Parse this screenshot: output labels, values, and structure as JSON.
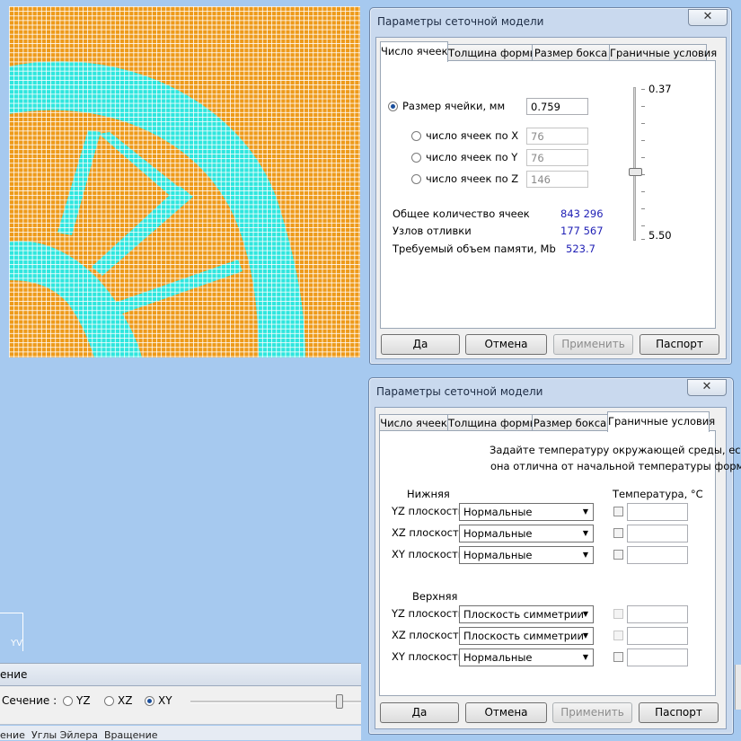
{
  "viewport": {
    "colors": {
      "mesh": "#ee9a1a",
      "casting": "#2fe6de",
      "grid": "#ffffff",
      "background": "#a6c9ef"
    }
  },
  "left_panel": {
    "axes_label": "YV",
    "section_header": "ение",
    "section_label": "Сечение :",
    "planes": [
      {
        "label": "YZ",
        "selected": false
      },
      {
        "label": "XZ",
        "selected": false
      },
      {
        "label": "XY",
        "selected": true
      }
    ],
    "bottom_tabs": [
      "ение",
      "Углы Эйлера",
      "Вращение"
    ]
  },
  "dialog1": {
    "title": "Параметры сеточной модели",
    "close": "✕",
    "tabs": [
      "Число ячеек",
      "Толщина формы",
      "Размер бокса",
      "Граничные условия"
    ],
    "active_tab": 0,
    "cell_size_label": "Размер ячейки, мм",
    "cell_size_value": "0.759",
    "cells_x_label": "число ячеек по X",
    "cells_x_value": "76",
    "cells_y_label": "число ячеек по Y",
    "cells_y_value": "76",
    "cells_z_label": "число ячеек по Z",
    "cells_z_value": "146",
    "total_cells_label": "Общее количество ячеек",
    "total_cells_value": "843 296",
    "casting_nodes_label": "Узлов отливки",
    "casting_nodes_value": "177 567",
    "memory_label": "Требуемый объем памяти, Mb",
    "memory_value": "523.7",
    "slider_max": "0.37",
    "slider_min": "5.50",
    "buttons": {
      "ok": "Да",
      "cancel": "Отмена",
      "apply": "Применить",
      "passport": "Паспорт"
    }
  },
  "dialog2": {
    "title": "Параметры сеточной модели",
    "close": "✕",
    "tabs": [
      "Число ячеек",
      "Толщина формы",
      "Размер бокса",
      "Граничные условия"
    ],
    "active_tab": 3,
    "hint_line1": "Задайте температуру окружающей среды, если",
    "hint_line2": "она отлична от начальной температуры формы",
    "lower_label": "Нижняя",
    "upper_label": "Верхняя",
    "temp_header": "Температура, °C",
    "lower": [
      {
        "plane": "YZ плоскость",
        "value": "Нормальные"
      },
      {
        "plane": "XZ плоскость",
        "value": "Нормальные"
      },
      {
        "plane": "XY плоскость",
        "value": "Нормальные"
      }
    ],
    "upper": [
      {
        "plane": "YZ плоскость",
        "value": "Плоскость симметрии"
      },
      {
        "plane": "XZ плоскость",
        "value": "Плоскость симметрии"
      },
      {
        "plane": "XY плоскость",
        "value": "Нормальные"
      }
    ],
    "buttons": {
      "ok": "Да",
      "cancel": "Отмена",
      "apply": "Применить",
      "passport": "Паспорт"
    }
  }
}
